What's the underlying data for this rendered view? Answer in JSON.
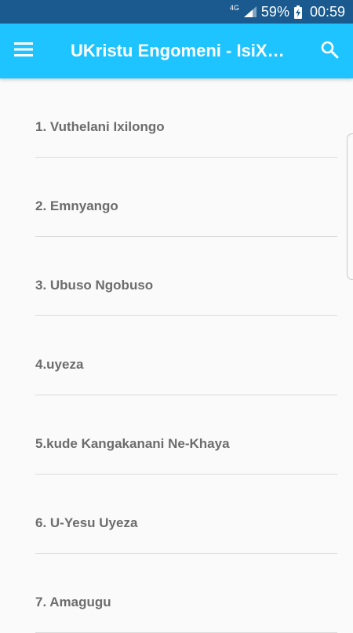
{
  "status_bar": {
    "network": "4G",
    "battery": "59%",
    "time": "00:59"
  },
  "toolbar": {
    "title": "UKristu Engomeni - IsiX…",
    "menu_icon": "hamburger-menu-icon",
    "search_icon": "search-icon",
    "background": "#1ec4ff"
  },
  "list": {
    "items": [
      "1. Vuthelani Ixilongo",
      "2. Emnyango",
      "3. Ubuso Ngobuso",
      "4.uyeza",
      "5.kude Kangakanani Ne-Khaya",
      "6. U-Yesu Uyeza",
      "7. Amagugu"
    ]
  },
  "colors": {
    "status_bar": "#1a5a8e",
    "item_text": "#6c6c6c",
    "divider": "#dcdcdc",
    "background": "#fafafa"
  }
}
